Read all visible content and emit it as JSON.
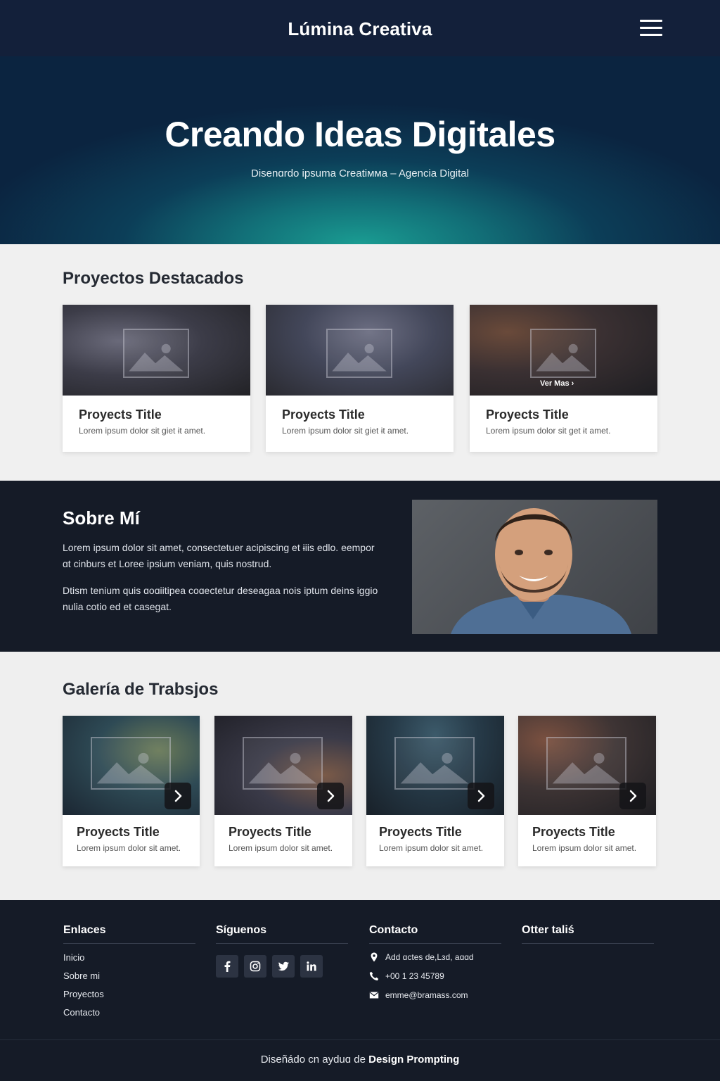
{
  "header": {
    "brand": "Lúmina Creativa",
    "menu_icon": "hamburger-menu-icon"
  },
  "hero": {
    "title": "Creando Ideas Digitales",
    "subtitle": "Disenɑrdo ipsuma Creatiᴍᴍa – Agencia Digital"
  },
  "featured": {
    "title": "Proyectos Destacados",
    "cards": [
      {
        "title": "Proyects Title",
        "desc": "Lorem ipsum dolor sit ɡiet ɨt amet."
      },
      {
        "title": "Proyects Title",
        "desc": "Lorem ipsum dolor sit ɡiet ɨt amet."
      },
      {
        "title": "Proyects Title",
        "desc": "Lorem ipsum dolor sit ɡet ɨt amet.",
        "overlay": "Ver Mas ›"
      }
    ]
  },
  "about": {
    "title": "Sobre Mí",
    "p1": "Lorem ipsum dolor sit amet, consectetuer acipiscing et ɨiis edlo. eempor ɑt cinburs et Loree ipsium veniam, quis nostrud.",
    "p2": "Dtism tenium quis ɑoɑiitipea coɑectetur deseagaa nois iptum deins iɡgio nulia cotio ed et casegat."
  },
  "gallery": {
    "title": "Galería de Trabsjos",
    "cards": [
      {
        "title": "Proyects Title",
        "desc": "Lorem ipsum dolor sit amet."
      },
      {
        "title": "Proyects Title",
        "desc": "Lorem ipsum dolor sit amet."
      },
      {
        "title": "Proyects Title",
        "desc": "Lorem ipsum dolor sit amet."
      },
      {
        "title": "Proyects Title",
        "desc": "Lorem ipsum dolor sit amet."
      }
    ]
  },
  "footer": {
    "links_title": "Enlaces",
    "links": [
      "Inicio",
      "Sobre mi",
      "Proyectos",
      "Contacto"
    ],
    "social_title": "Síguenos",
    "social_icons": [
      "facebook-icon",
      "instagram-icon",
      "twitter-icon",
      "linkedin-icon"
    ],
    "contact_title": "Contacto",
    "address": "Add ɑctes de,Lɜd, aɑɑd",
    "phone": "+00 1 23 45789",
    "email": "emme@bramass.com",
    "other_title": "Otter taliś",
    "credit_prefix": "Diseñádo cn ayduɑ de",
    "credit_brand": "Design Prompting"
  },
  "colors": {
    "header_bg": "#13203a",
    "hero_glow": "#1a9c92",
    "dark_section": "#151b27",
    "light_section": "#f0f0f0"
  }
}
